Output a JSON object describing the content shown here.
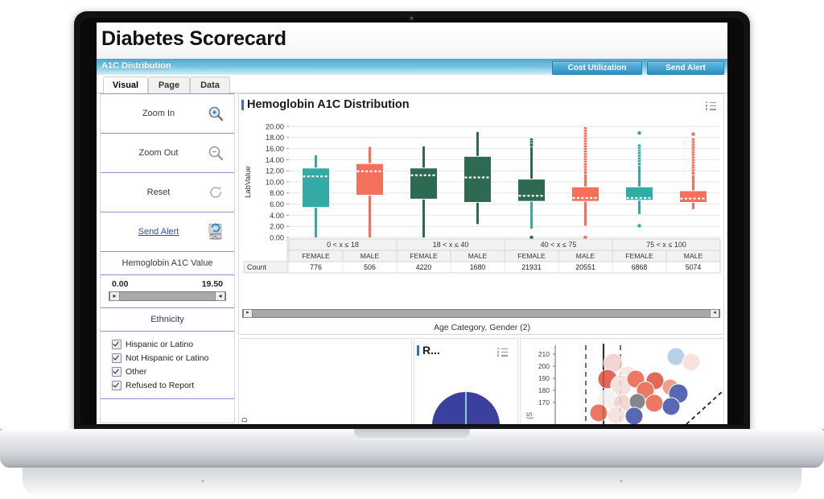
{
  "app": {
    "title": "Diabetes Scorecard",
    "section_label": "A1C Distribution",
    "top_buttons": [
      {
        "label": "Cost Utilization",
        "name": "cost-utilization-button"
      },
      {
        "label": "Send Alert",
        "name": "send-alert-button"
      }
    ],
    "tabs": [
      {
        "label": "Visual",
        "active": true
      },
      {
        "label": "Page",
        "active": false
      },
      {
        "label": "Data",
        "active": false
      }
    ]
  },
  "sidebar": {
    "actions": [
      {
        "label": "Zoom In",
        "icon": "zoom-in-icon"
      },
      {
        "label": "Zoom Out",
        "icon": "zoom-out-icon"
      },
      {
        "label": "Reset",
        "icon": "reset-icon"
      },
      {
        "label": "Send Alert",
        "icon": "ecw-send-icon",
        "link": true
      }
    ],
    "filter_title": "Hemoglobin A1C Value",
    "slider": {
      "min": "0.00",
      "max": "19.50",
      "left_arrow": "▸",
      "right_arrow": "◂"
    },
    "ethnicity_title": "Ethnicity",
    "ethnicity_options": [
      {
        "label": "Hispanic or Latino",
        "checked": true
      },
      {
        "label": "Not Hispanic or Latino",
        "checked": true
      },
      {
        "label": "Other",
        "checked": true
      },
      {
        "label": "Refused to Report",
        "checked": true
      }
    ]
  },
  "panel": {
    "title": "Hemoglobin A1C Distribution",
    "legend_icon": "list-legend-icon",
    "scroll_left_arrow": "▸",
    "scroll_right_arrow": "◂"
  },
  "lower_panels": [
    {
      "title": "",
      "name": "lower-panel-left"
    },
    {
      "title": "R...",
      "name": "lower-panel-pie"
    },
    {
      "title": "",
      "name": "lower-panel-scatter"
    }
  ],
  "colors": {
    "teal": "#33aaa6",
    "orange": "#f4705a",
    "green": "#2e6a51",
    "accent_blue": "#3d6fb5",
    "bar_blue": "#4aa8d0",
    "link_blue": "#2b4fb8",
    "divider": "#8a94c8"
  },
  "chart_data": {
    "type": "box",
    "title": "Hemoglobin A1C Distribution",
    "ylabel": "LabValue",
    "xlabel": "Age Category,  Gender (2)",
    "ylim": [
      0,
      20
    ],
    "yticks": [
      "0.00",
      "2.00",
      "4.00",
      "6.00",
      "8.00",
      "10.00",
      "12.00",
      "14.00",
      "16.00",
      "18.00",
      "20.00"
    ],
    "grid": true,
    "legend": "none",
    "group_headers": [
      "0 < x ≤ 18",
      "18 < x ≤ 40",
      "40 < x ≤ 75",
      "75 < x ≤ 100"
    ],
    "sub_headers": [
      "FEMALE",
      "MALE",
      "FEMALE",
      "MALE",
      "FEMALE",
      "MALE",
      "FEMALE",
      "MALE"
    ],
    "count_row_label": "Count",
    "counts": [
      776,
      506,
      4220,
      1680,
      21931,
      20551,
      6868,
      5074
    ],
    "boxes": [
      {
        "group": "0 < x ≤ 18",
        "gender": "FEMALE",
        "color": "#33aaa6",
        "whisker_high": 14.8,
        "q3": 12.5,
        "median": 11.0,
        "q1": 5.4,
        "whisker_low": 0.0,
        "outliers": []
      },
      {
        "group": "0 < x ≤ 18",
        "gender": "MALE",
        "color": "#f4705a",
        "whisker_high": 16.3,
        "q3": 13.3,
        "median": 11.9,
        "q1": 7.6,
        "whisker_low": 0.0,
        "outliers": []
      },
      {
        "group": "18 < x ≤ 40",
        "gender": "FEMALE",
        "color": "#2e6a51",
        "whisker_high": 16.4,
        "q3": 12.5,
        "median": 11.2,
        "q1": 6.9,
        "whisker_low": 0.0,
        "outliers": []
      },
      {
        "group": "18 < x ≤ 40",
        "gender": "MALE",
        "color": "#2e6a51",
        "whisker_high": 19.0,
        "q3": 14.6,
        "median": 10.8,
        "q1": 6.3,
        "whisker_low": 2.4,
        "outliers": []
      },
      {
        "group": "40 < x ≤ 75",
        "gender": "FEMALE",
        "color": "#2e6a51",
        "whisker_high": 17.6,
        "q3": 10.5,
        "median": 7.5,
        "q1": 6.5,
        "whisker_low": 1.6,
        "outliers": [
          0.0
        ],
        "whisker_color": "#33aaa6",
        "dense_top": [
          16.4,
          17.6
        ]
      },
      {
        "group": "40 < x ≤ 75",
        "gender": "MALE",
        "color": "#f4705a",
        "whisker_high": 19.6,
        "q3": 9.1,
        "median": 7.1,
        "q1": 6.5,
        "whisker_low": 2.1,
        "outliers": [
          0.0
        ],
        "dense_top": [
          11.6,
          19.6
        ]
      },
      {
        "group": "75 < x ≤ 100",
        "gender": "FEMALE",
        "color": "#33aaa6",
        "whisker_high": 16.5,
        "q3": 9.1,
        "median": 7.1,
        "q1": 6.7,
        "whisker_low": 4.2,
        "outliers": [
          18.8,
          2.1
        ],
        "dense_top": [
          13.0,
          16.5
        ]
      },
      {
        "group": "75 < x ≤ 100",
        "gender": "MALE",
        "color": "#f4705a",
        "whisker_high": 17.6,
        "q3": 8.4,
        "median": 7.0,
        "q1": 6.3,
        "whisker_low": 5.1,
        "outliers": [
          18.6
        ],
        "dense_top": [
          11.4,
          17.6
        ]
      }
    ]
  }
}
